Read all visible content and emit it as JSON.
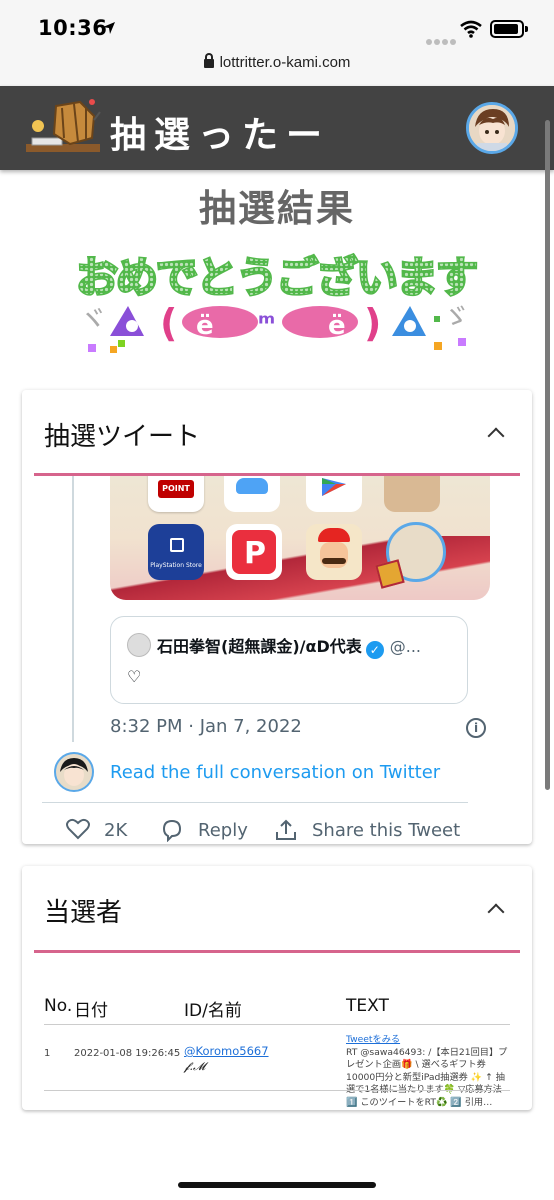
{
  "status_bar": {
    "time": "10:36"
  },
  "browser": {
    "url": "lottritter.o-kami.com"
  },
  "header": {
    "logo_text": "抽選ったー"
  },
  "page": {
    "title": "抽選結果",
    "congrats_text": "おめでとうございます"
  },
  "tweet_card": {
    "title": "抽選ツイート",
    "quote_name": "石田拳智(超無課金)/αD代表",
    "quote_handle": "@...",
    "quote_body": "♡",
    "timestamp": "8:32 PM · Jan 7, 2022",
    "read_full": "Read the full conversation on Twitter",
    "likes": "2K",
    "reply_label": "Reply",
    "share_label": "Share this Tweet",
    "app_labels": {
      "point": "POINT",
      "playstation": "PlayStation Store"
    }
  },
  "winners_card": {
    "title": "当選者",
    "columns": [
      "No.",
      "日付",
      "ID/名前",
      "TEXT"
    ],
    "rows": [
      {
        "no": "1",
        "date": "2022-01-08 19:26:45",
        "user_id": "@Koromo5667",
        "user_name": "𝓯.𝓜",
        "tweet_link": "Tweetをみる",
        "text": "RT @sawa46493: /【本日21回目】プレゼント企画🎁 \\ 選べるギフト券10000円分と新型iPad抽選券 ✨ ↑ 抽選で1名様に当たります🍀 ▽応募方法 1️⃣ このツイートをRT♻️ 2️⃣ 引用…"
      }
    ]
  },
  "colors": {
    "header_bg": "#434343",
    "accent_pink": "#d6648c",
    "twitter_blue": "#1d9bf0",
    "link_blue": "#1d6fd8"
  }
}
